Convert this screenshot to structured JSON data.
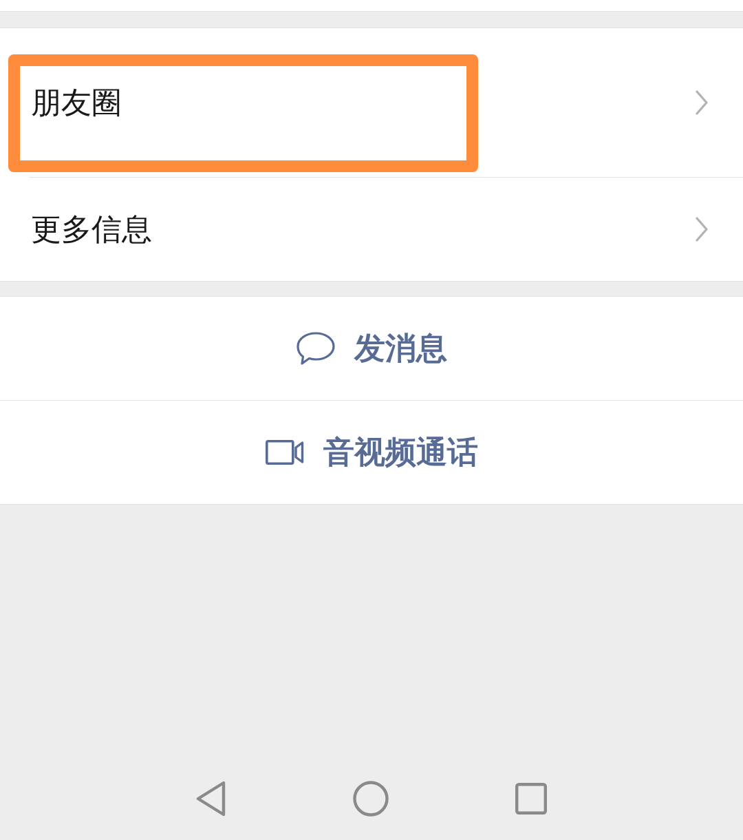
{
  "menu_items": [
    {
      "label": "朋友圈",
      "highlighted": true
    },
    {
      "label": "更多信息",
      "highlighted": false
    }
  ],
  "actions": [
    {
      "kind": "message",
      "label": "发消息"
    },
    {
      "kind": "video-call",
      "label": "音视频通话"
    }
  ],
  "nav_bar": [
    {
      "kind": "back"
    },
    {
      "kind": "home"
    },
    {
      "kind": "recents"
    }
  ]
}
